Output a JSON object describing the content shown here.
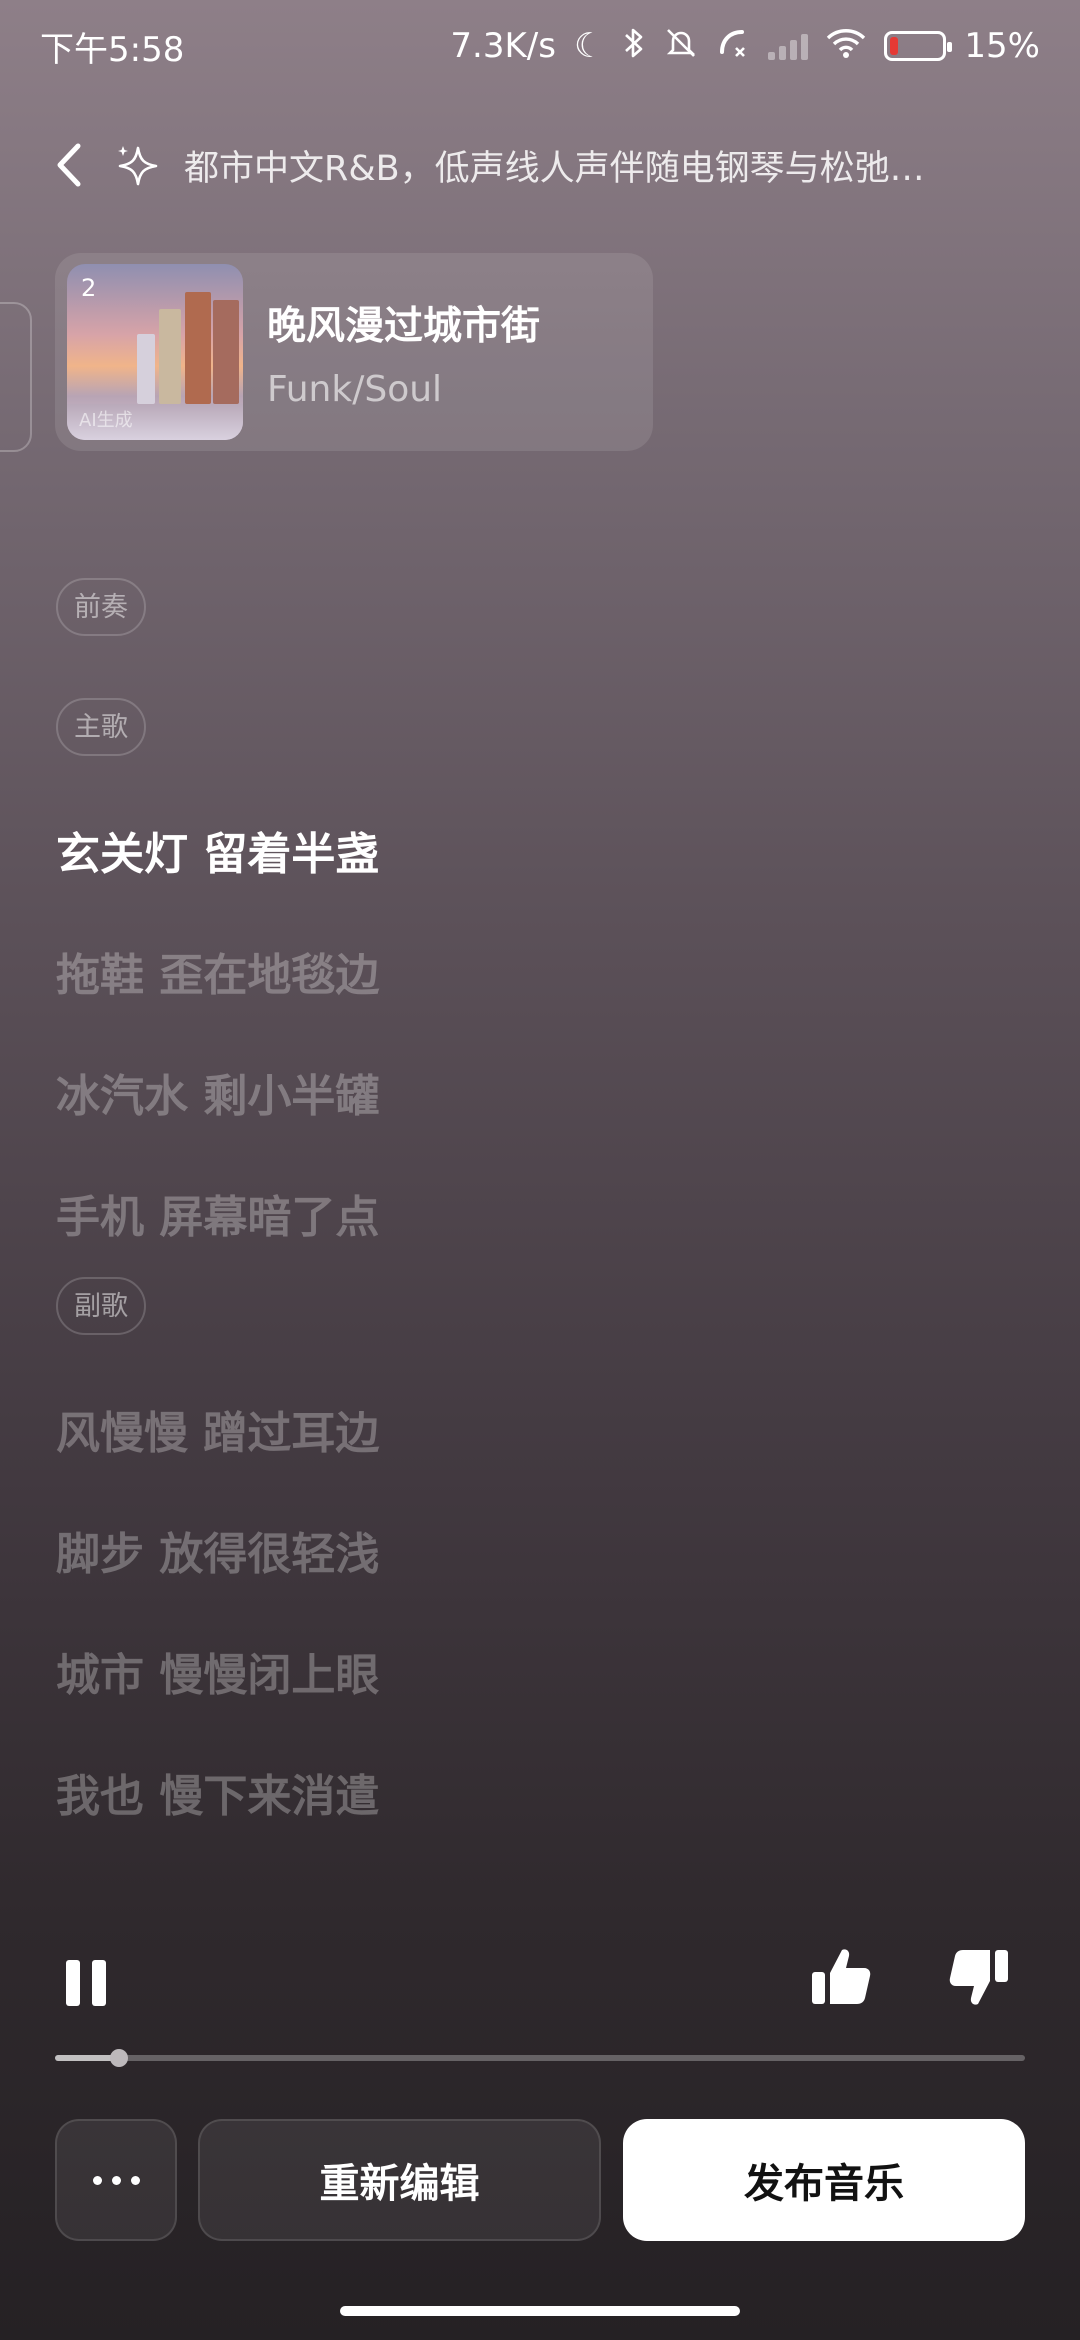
{
  "status_bar": {
    "time": "下午5:58",
    "network_speed": "7.3K/s",
    "battery_percent": "15%",
    "battery_level": 0.15,
    "icons": [
      "moon-icon",
      "bluetooth-icon",
      "mute-icon",
      "call-icon",
      "signal-icon",
      "wifi-icon",
      "battery-icon"
    ]
  },
  "header": {
    "title": "都市中文R&B，低声线人声伴随电钢琴与松弛…"
  },
  "song": {
    "index": "2",
    "ai_label": "AI生成",
    "title": "晚风漫过城市街",
    "genre": "Funk/Soul"
  },
  "lyrics": {
    "tag_intro": "前奏",
    "tag_verse": "主歌",
    "verse": [
      "玄关灯 留着半盏",
      "拖鞋 歪在地毯边",
      "冰汽水 剩小半罐",
      "手机 屏幕暗了点"
    ],
    "tag_chorus": "副歌",
    "chorus": [
      "风慢慢 蹭过耳边",
      "脚步 放得很轻浅",
      "城市 慢慢闭上眼",
      "我也 慢下来消遣"
    ]
  },
  "player": {
    "progress": 0.066
  },
  "buttons": {
    "reedit": "重新编辑",
    "publish": "发布音乐"
  }
}
